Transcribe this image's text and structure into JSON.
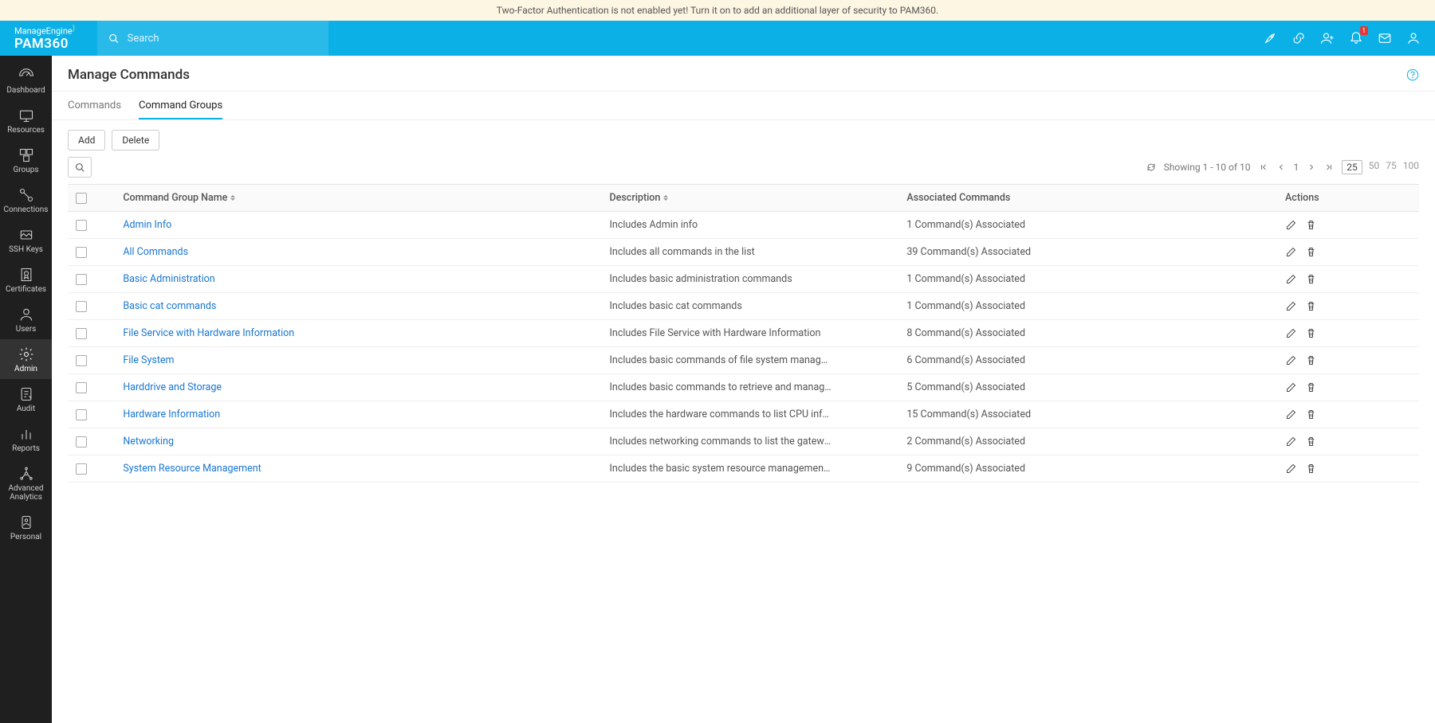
{
  "banner": "Two-Factor Authentication is not enabled yet! Turn it on to add an additional layer of security to PAM360.",
  "brand": {
    "top": "ManageEngine",
    "bot": "PAM360"
  },
  "search": {
    "placeholder": "Search"
  },
  "sidenav": [
    {
      "label": "Dashboard"
    },
    {
      "label": "Resources"
    },
    {
      "label": "Groups"
    },
    {
      "label": "Connections"
    },
    {
      "label": "SSH Keys"
    },
    {
      "label": "Certificates"
    },
    {
      "label": "Users"
    },
    {
      "label": "Admin",
      "active": true
    },
    {
      "label": "Audit"
    },
    {
      "label": "Reports"
    },
    {
      "label": "Advanced Analytics"
    },
    {
      "label": "Personal"
    }
  ],
  "page": {
    "title": "Manage Commands"
  },
  "tabs": [
    {
      "label": "Commands"
    },
    {
      "label": "Command Groups",
      "active": true
    }
  ],
  "buttons": {
    "add": "Add",
    "delete": "Delete"
  },
  "pager": {
    "showing": "Showing 1 - 10 of 10",
    "page": "1",
    "sizes": [
      "25",
      "50",
      "75",
      "100"
    ],
    "activeSize": "25"
  },
  "columns": {
    "name": "Command Group Name",
    "desc": "Description",
    "assoc": "Associated Commands",
    "actions": "Actions"
  },
  "rows": [
    {
      "name": "Admin Info",
      "desc": "Includes Admin info",
      "assoc": "1 Command(s) Associated"
    },
    {
      "name": "All Commands",
      "desc": "Includes all commands in the list",
      "assoc": "39 Command(s) Associated"
    },
    {
      "name": "Basic Administration",
      "desc": "Includes basic administration commands",
      "assoc": "1 Command(s) Associated"
    },
    {
      "name": "Basic cat commands",
      "desc": "Includes basic cat commands",
      "assoc": "1 Command(s) Associated"
    },
    {
      "name": "File Service with Hardware Information",
      "desc": "Includes File Service with Hardware Information",
      "assoc": "8 Command(s) Associated"
    },
    {
      "name": "File System",
      "desc": "Includes basic commands of file system management",
      "assoc": "6 Command(s) Associated"
    },
    {
      "name": "Harddrive and Storage",
      "desc": "Includes basic commands to retrieve and manage hard...",
      "assoc": "5 Command(s) Associated"
    },
    {
      "name": "Hardware Information",
      "desc": "Includes the hardware commands to list CPU informati...",
      "assoc": "15 Command(s) Associated"
    },
    {
      "name": "Networking",
      "desc": "Includes networking commands to list the gateway, IP, ...",
      "assoc": "2 Command(s) Associated"
    },
    {
      "name": "System Resource Management",
      "desc": "Includes the basic system resource management com...",
      "assoc": "9 Command(s) Associated"
    }
  ]
}
